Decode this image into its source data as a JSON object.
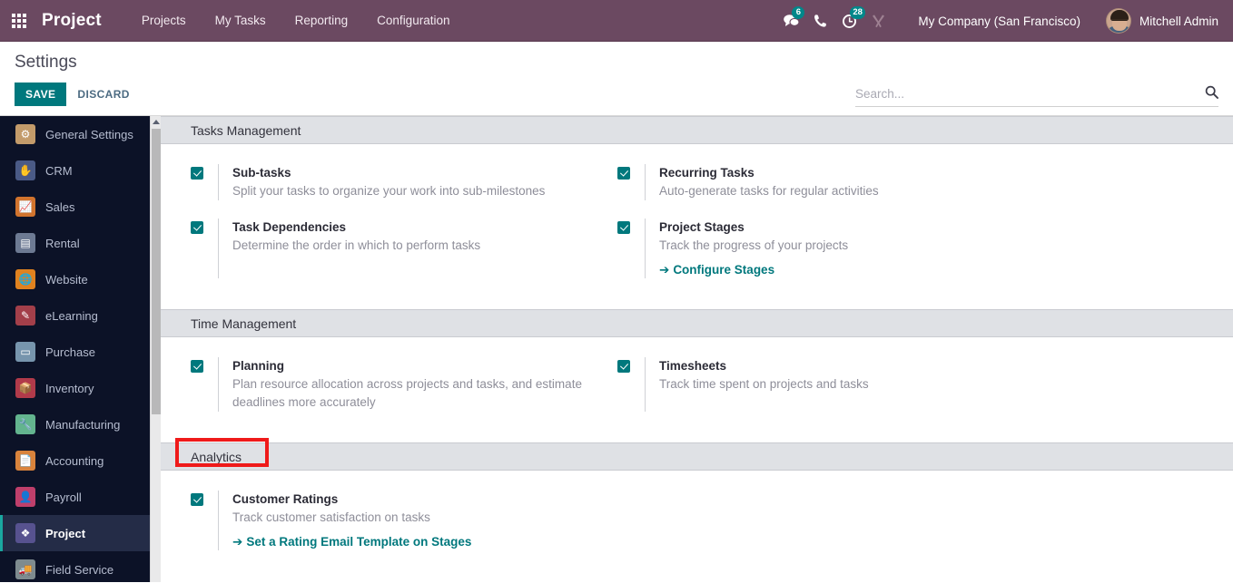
{
  "navbar": {
    "apps_icon": "apps-grid-icon",
    "brand": "Project",
    "menu": [
      {
        "label": "Projects"
      },
      {
        "label": "My Tasks"
      },
      {
        "label": "Reporting"
      },
      {
        "label": "Configuration"
      }
    ],
    "sys_icons": [
      {
        "name": "messages-icon",
        "glyph": "💬",
        "badge": "6"
      },
      {
        "name": "phone-icon",
        "glyph": "📞",
        "badge": ""
      },
      {
        "name": "activities-clock-icon",
        "glyph": "◴",
        "badge": "28"
      },
      {
        "name": "developer-tools-icon",
        "glyph": "⚒",
        "badge": ""
      }
    ],
    "company": "My Company (San Francisco)",
    "user": "Mitchell Admin"
  },
  "control_panel": {
    "title": "Settings",
    "save_label": "SAVE",
    "discard_label": "DISCARD",
    "search_placeholder": "Search...",
    "search_value": ""
  },
  "sidebar": {
    "items": [
      {
        "label": "General Settings",
        "icon": "gear-icon",
        "glyph": "⚙",
        "bg": "#c39b6a",
        "active": false
      },
      {
        "label": "CRM",
        "icon": "handshake-icon",
        "glyph": "✋",
        "bg": "#4a5a86",
        "active": false
      },
      {
        "label": "Sales",
        "icon": "chart-line-icon",
        "glyph": "📈",
        "bg": "#d2742e",
        "active": false
      },
      {
        "label": "Rental",
        "icon": "calendar-icon",
        "glyph": "▤",
        "bg": "#6d7a93",
        "active": false
      },
      {
        "label": "Website",
        "icon": "globe-icon",
        "glyph": "🌐",
        "bg": "#e0821f",
        "active": false
      },
      {
        "label": "eLearning",
        "icon": "graduation-icon",
        "glyph": "✎",
        "bg": "#a33f4a",
        "active": false
      },
      {
        "label": "Purchase",
        "icon": "card-icon",
        "glyph": "▭",
        "bg": "#7795ad",
        "active": false
      },
      {
        "label": "Inventory",
        "icon": "box-icon",
        "glyph": "📦",
        "bg": "#b13a4a",
        "active": false
      },
      {
        "label": "Manufacturing",
        "icon": "wrench-icon",
        "glyph": "🔧",
        "bg": "#63b48e",
        "active": false
      },
      {
        "label": "Accounting",
        "icon": "invoice-icon",
        "glyph": "📄",
        "bg": "#d9833c",
        "active": false
      },
      {
        "label": "Payroll",
        "icon": "employee-icon",
        "glyph": "👤",
        "bg": "#bf3f6b",
        "active": false
      },
      {
        "label": "Project",
        "icon": "puzzle-icon",
        "glyph": "❖",
        "bg": "#57528f",
        "active": true
      },
      {
        "label": "Field Service",
        "icon": "truck-icon",
        "glyph": "🚚",
        "bg": "#7e8b8f",
        "active": false
      }
    ]
  },
  "settings": {
    "sections": [
      {
        "id": "tasks-management",
        "title": "Tasks Management",
        "highlighted": false,
        "items": [
          {
            "title": "Sub-tasks",
            "desc": "Split your tasks to organize your work into sub-milestones",
            "checked": true,
            "link": null
          },
          {
            "title": "Recurring Tasks",
            "desc": "Auto-generate tasks for regular activities",
            "checked": true,
            "link": null
          },
          {
            "title": "Task Dependencies",
            "desc": "Determine the order in which to perform tasks",
            "checked": true,
            "link": null
          },
          {
            "title": "Project Stages",
            "desc": "Track the progress of your projects",
            "checked": true,
            "link": "Configure Stages"
          }
        ]
      },
      {
        "id": "time-management",
        "title": "Time Management",
        "highlighted": false,
        "items": [
          {
            "title": "Planning",
            "desc": "Plan resource allocation across projects and tasks, and estimate deadlines more accurately",
            "checked": true,
            "link": null
          },
          {
            "title": "Timesheets",
            "desc": "Track time spent on projects and tasks",
            "checked": true,
            "link": null
          }
        ]
      },
      {
        "id": "analytics",
        "title": "Analytics",
        "highlighted": true,
        "items": [
          {
            "title": "Customer Ratings",
            "desc": "Track customer satisfaction on tasks",
            "checked": true,
            "link": "Set a Rating Email Template on Stages"
          }
        ]
      }
    ]
  },
  "colors": {
    "navbar_bg": "#6b4961",
    "accent_teal": "#00787d",
    "badge_teal": "#00878a",
    "sidebar_bg": "#0c1227",
    "sidebar_active_bg": "#242c47",
    "section_header_bg": "#dfe1e5",
    "annotation_red": "#ef1a1a"
  },
  "annotation": {
    "label": "analytics-section-highlight",
    "color": "#ef1a1a"
  }
}
